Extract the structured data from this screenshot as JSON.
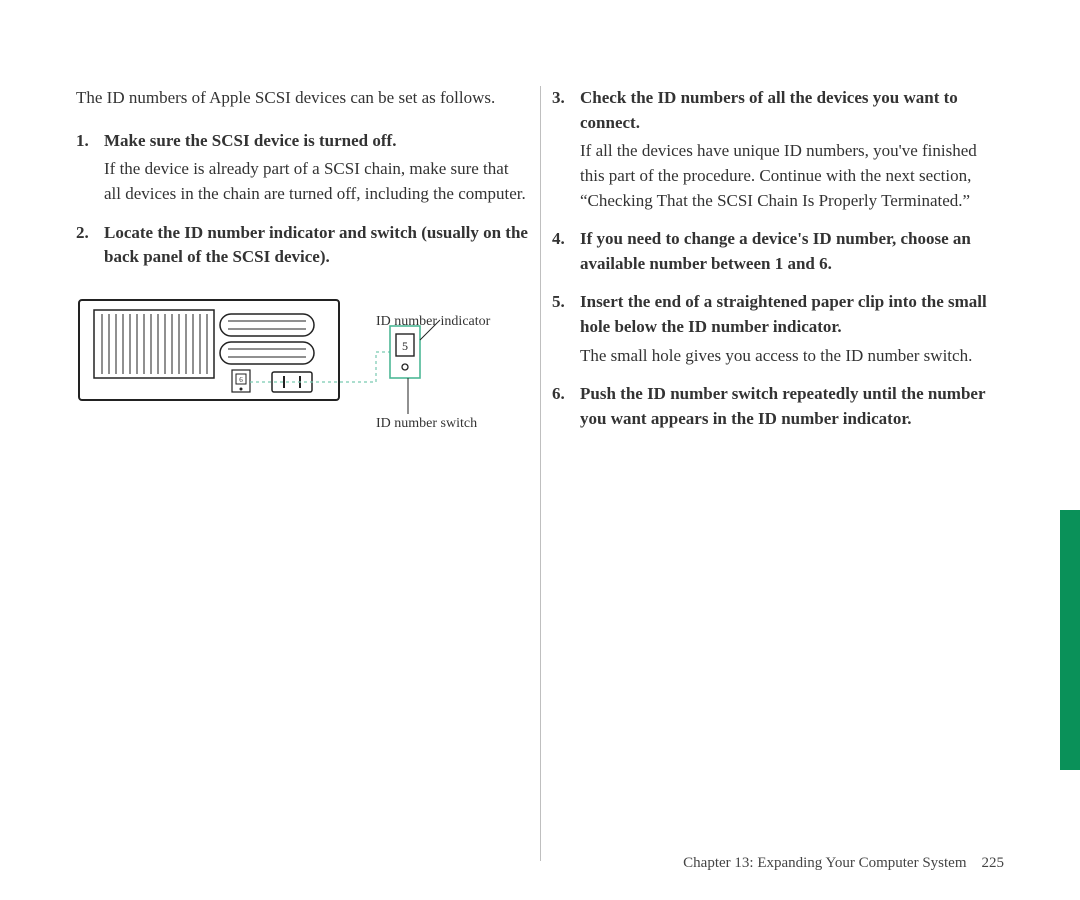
{
  "intro": "The ID numbers of Apple SCSI devices can be set as follows.",
  "left": {
    "step1": {
      "num": "1.",
      "title": "Make sure the SCSI device is turned off.",
      "body": "If the device is already part of a SCSI chain, make sure that all devices in the chain are turned off, including the computer."
    },
    "step2": {
      "num": "2.",
      "title": "Locate the ID number indicator and switch (usually on the back panel of the SCSI device)."
    }
  },
  "right": {
    "step3": {
      "num": "3.",
      "title": "Check the ID numbers of all the devices you want to connect.",
      "body": "If all the devices have unique ID numbers, you've finished this part of the procedure. Continue with the next section, “Checking That the SCSI Chain Is Properly Terminated.”"
    },
    "step4": {
      "num": "4.",
      "title": "If you need to change a device's ID number, choose an available number between 1 and 6."
    },
    "step5": {
      "num": "5.",
      "title": "Insert the end of a straightened paper clip into the small hole below the ID number indicator.",
      "body": "The small hole gives you access to the ID number switch."
    },
    "step6": {
      "num": "6.",
      "title": "Push the ID number switch repeatedly until the number you want appears in the ID number indicator."
    }
  },
  "diagram": {
    "label_indicator": "ID number indicator",
    "label_switch": "ID number switch",
    "indicator_value": "6",
    "callout_value": "5"
  },
  "footer": {
    "chapter": "Chapter 13:  Expanding Your Computer System",
    "page": "225"
  }
}
